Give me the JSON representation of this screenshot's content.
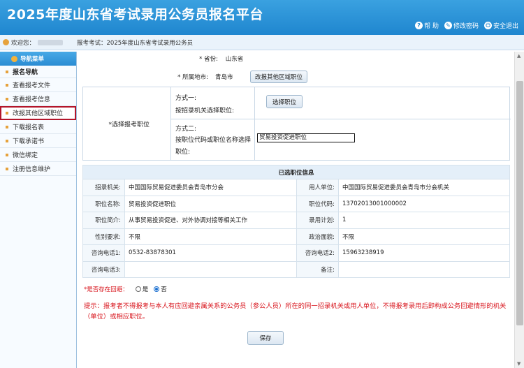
{
  "header": {
    "title": "2025年度山东省考试录用公务员报名平台",
    "links": [
      {
        "icon": "help-icon",
        "label": "帮 助"
      },
      {
        "icon": "password-icon",
        "label": "修改密码"
      },
      {
        "icon": "power-icon",
        "label": "安全退出"
      }
    ]
  },
  "infobar": {
    "welcome": "欢迎您：",
    "exam": "报考考试：2025年度山东省考试录用公务员"
  },
  "sidebar": {
    "header": "导航菜单",
    "section": "报名导航",
    "items": [
      "查看报考文件",
      "查看报考信息",
      "改报其他区域职位",
      "下载报名表",
      "下载承诺书",
      "微信绑定",
      "注册信息维护"
    ]
  },
  "form": {
    "province_label": "* 省份:",
    "province_value": "山东省",
    "city_label": "* 所属地市:",
    "city_value": "青岛市",
    "change_region_button": "改报其他区域职位",
    "select_position_label": "*选择报考职位",
    "method1_title": "方式一:",
    "method1_desc": "按招录机关选择职位:",
    "select_position_button": "选择职位",
    "method2_title": "方式二:",
    "method2_desc_line1": "按职位代码或职位名称选择",
    "method2_desc_line2": "职位:",
    "position_input_value": "贸易投资促进职位"
  },
  "selected": {
    "heading": "已选职位信息",
    "rows": [
      {
        "k1": "招录机关:",
        "v1": "中国国际贸易促进委员会青岛市分会",
        "k2": "用人单位:",
        "v2": "中国国际贸易促进委员会青岛市分会机关"
      },
      {
        "k1": "职位名称:",
        "v1": "贸易投资促进职位",
        "k2": "职位代码:",
        "v2": "13702013001000002"
      },
      {
        "k1": "职位简介:",
        "v1": "从事贸易投资促进、对外协调对接等相关工作",
        "k2": "录用计划:",
        "v2": "1"
      },
      {
        "k1": "性别要求:",
        "v1": "不限",
        "k2": "政治面貌:",
        "v2": "不限"
      },
      {
        "k1": "咨询电话1:",
        "v1": "0532-83878301",
        "k2": "咨询电话2:",
        "v2": "15963238919"
      },
      {
        "k1": "咨询电话3:",
        "v1": "",
        "k2": "备注:",
        "v2": ""
      }
    ]
  },
  "avoidance": {
    "question": "*是否存在回避：",
    "yes": "是",
    "no": "否",
    "selected": "否"
  },
  "notice": "提示：报考者不得报考与本人有应回避亲属关系的公务员（参公人员）所在的同一招录机关或用人单位，不得报考录用后即构成公务回避情形的机关（单位）或相应职位。",
  "save_button": "保存",
  "colors": {
    "header": "#1f86cf",
    "highlight": "#b3152a",
    "warning": "#d8151d"
  }
}
